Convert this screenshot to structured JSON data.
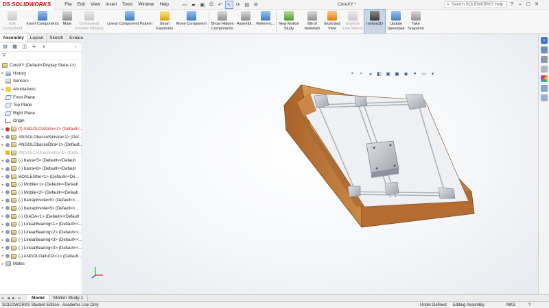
{
  "app": {
    "logo_prefix": "DS",
    "logo_text": "SOLIDWORKS",
    "doc_title": "CoreXY *",
    "search_placeholder": "Search SOLIDWORKS Help"
  },
  "menu": [
    "File",
    "Edit",
    "View",
    "Insert",
    "Tools",
    "Window",
    "Help"
  ],
  "commands": [
    {
      "label": "Edit\nComponent",
      "state": "disabled"
    },
    {
      "label": "Insert Components",
      "state": "normal"
    },
    {
      "label": "Mate",
      "state": "normal"
    },
    {
      "label": "Component\nPreview Window",
      "state": "disabled"
    },
    {
      "label": "Linear Component Pattern",
      "state": "normal"
    },
    {
      "label": "Smart\nFasteners",
      "state": "normal"
    },
    {
      "label": "Move Component",
      "state": "normal"
    },
    {
      "label": "Show Hidden\nComponents",
      "state": "normal"
    },
    {
      "label": "Assembl...",
      "state": "normal"
    },
    {
      "label": "Referenc...",
      "state": "normal"
    },
    {
      "label": "New Motion\nStudy",
      "state": "normal"
    },
    {
      "label": "Bill of\nMaterials",
      "state": "normal"
    },
    {
      "label": "Exploded\nView",
      "state": "normal"
    },
    {
      "label": "Explode\nLine Sketch",
      "state": "disabled"
    },
    {
      "label": "Instant3D",
      "state": "active"
    },
    {
      "label": "Update\nSpeedpak",
      "state": "normal"
    },
    {
      "label": "Take\nSnapshot",
      "state": "normal"
    }
  ],
  "panel_tabs": [
    "Assembly",
    "Layout",
    "Sketch",
    "Evaluate"
  ],
  "tree": {
    "root": "CoreXY  (Default<Display State-1>)",
    "items": [
      {
        "label": "History",
        "kind": "history",
        "expand": true
      },
      {
        "label": "Sensors",
        "kind": "sensors",
        "expand": false
      },
      {
        "label": "Annotations",
        "kind": "annotations",
        "expand": true
      },
      {
        "label": "Front Plane",
        "kind": "plane",
        "expand": false
      },
      {
        "label": "Top Plane",
        "kind": "plane",
        "expand": false
      },
      {
        "label": "Right Plane",
        "kind": "plane",
        "expand": false
      },
      {
        "label": "Origin",
        "kind": "origin",
        "expand": false
      },
      {
        "label": "(f) ANGOLOAltoSx<1> (Default<...",
        "kind": "part",
        "status": "error",
        "expand": true
      },
      {
        "label": "ANGOLObassoSinistra<1> (Def...",
        "kind": "part",
        "status": "gear",
        "expand": true
      },
      {
        "label": "ANGOLObassoDtra<1> (Default...",
        "kind": "part",
        "status": "gear",
        "expand": true
      },
      {
        "label": "ANGOLOAltoaDestra<1> (Defa...",
        "kind": "part",
        "status": "warn",
        "expand": false
      },
      {
        "label": "(-) barra<5> (Default<<Default",
        "kind": "part",
        "status": "gear",
        "expand": true
      },
      {
        "label": "(-) barra<6> (Default<<Default",
        "kind": "part",
        "status": "gear",
        "expand": true
      },
      {
        "label": "BOXLEGNo<1> (Default<<De...",
        "kind": "part",
        "status": "gear",
        "expand": true
      },
      {
        "label": "(-) Mobile<1> (Default<<Default",
        "kind": "part",
        "status": "gear",
        "expand": true
      },
      {
        "label": "(-) Mobile<2> (Default<<Default",
        "kind": "part",
        "status": "gear",
        "expand": true
      },
      {
        "label": "(-) barrapivvola<5> (Default<<...",
        "kind": "part",
        "status": "gear",
        "expand": true
      },
      {
        "label": "(-) barrapivvola<6> (Default<<...",
        "kind": "part",
        "status": "gear",
        "expand": true
      },
      {
        "label": "(-) GIADA<1> (Default<<Default",
        "kind": "part",
        "status": "gear",
        "expand": true
      },
      {
        "label": "(-) LinearBearing<1> (Default<<...",
        "kind": "part",
        "status": "gear",
        "expand": true
      },
      {
        "label": "(-) LinearBearing<2> (Default<<...",
        "kind": "part",
        "status": "gear",
        "expand": true
      },
      {
        "label": "(-) LinearBearing<3> (Default<<...",
        "kind": "part",
        "status": "gear",
        "expand": true
      },
      {
        "label": "(-) LinearBearing<4> (Default<<...",
        "kind": "part",
        "status": "gear",
        "expand": true
      },
      {
        "label": "(-) ANGOLOaltoDX<1> (Default...",
        "kind": "part",
        "status": "gear",
        "expand": true
      },
      {
        "label": "Mates",
        "kind": "mates",
        "expand": true
      }
    ]
  },
  "bottom_tabs": [
    "Model",
    "Motion Study 1"
  ],
  "status": {
    "edition": "SOLIDWORKS Student Edition - Academic Use Only",
    "definition": "Under Defined",
    "mode": "Editing Assembly",
    "units": "MKS"
  },
  "colors": {
    "wood": "#c27c3e",
    "wood_dark": "#8e4f1f",
    "metal": "#b9bcc4",
    "rod": "#c9ccd3",
    "accent_red": "#d40000"
  }
}
